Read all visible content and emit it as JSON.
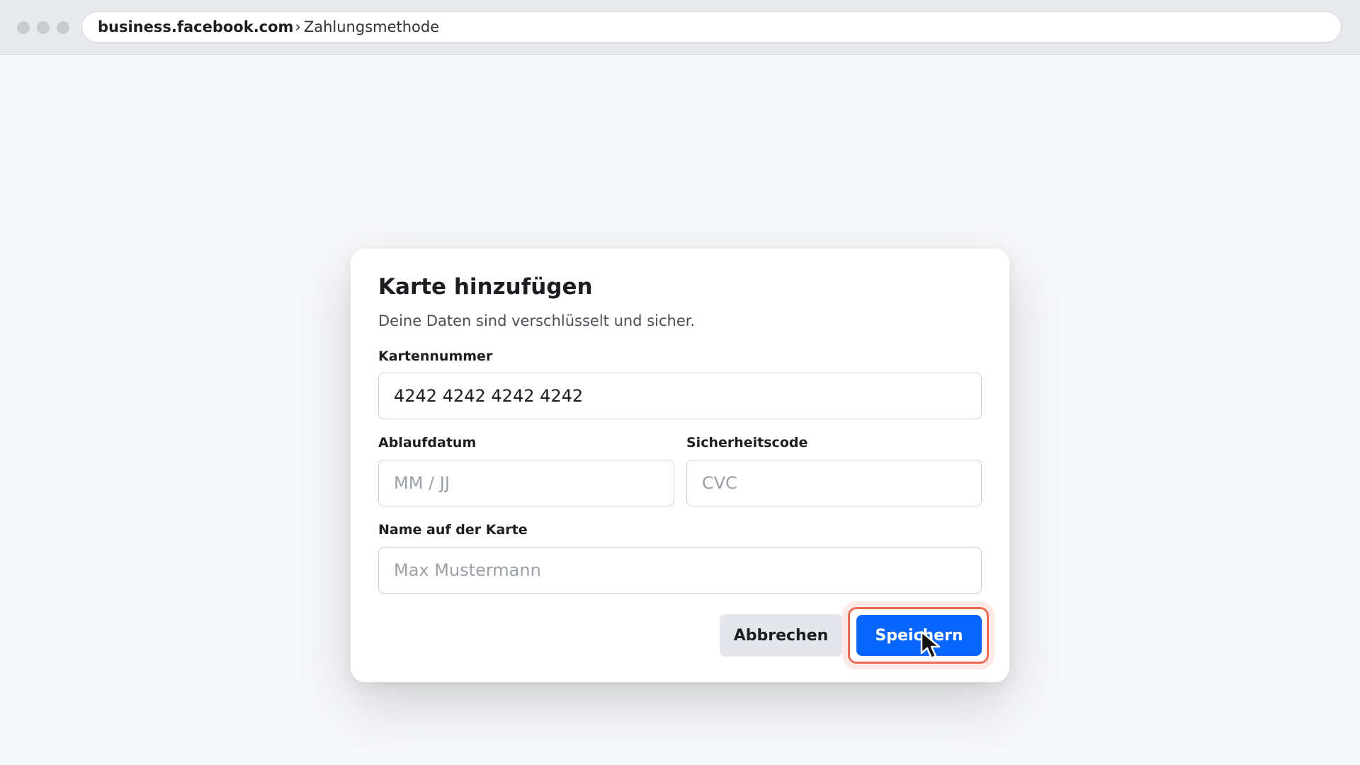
{
  "browser": {
    "url_domain": "business.facebook.com",
    "url_separator": "›",
    "url_page": "Zahlungsmethode"
  },
  "modal": {
    "title": "Karte hinzufügen",
    "subtitle": "Deine Daten sind verschlüsselt und sicher.",
    "card_number": {
      "label": "Kartennummer",
      "value": "4242 4242 4242 4242"
    },
    "expiry": {
      "label": "Ablaufdatum",
      "placeholder": "MM / JJ"
    },
    "cvc": {
      "label": "Sicherheitscode",
      "placeholder": "CVC"
    },
    "name": {
      "label": "Name auf der Karte",
      "placeholder": "Max Mustermann"
    },
    "cancel_label": "Abbrechen",
    "save_label": "Speichern"
  },
  "colors": {
    "primary_button": "#0866ff",
    "highlight": "#ee6a55",
    "secondary_button": "#e4e6eb"
  },
  "icons": {
    "cursor": "mouse-pointer-icon"
  }
}
